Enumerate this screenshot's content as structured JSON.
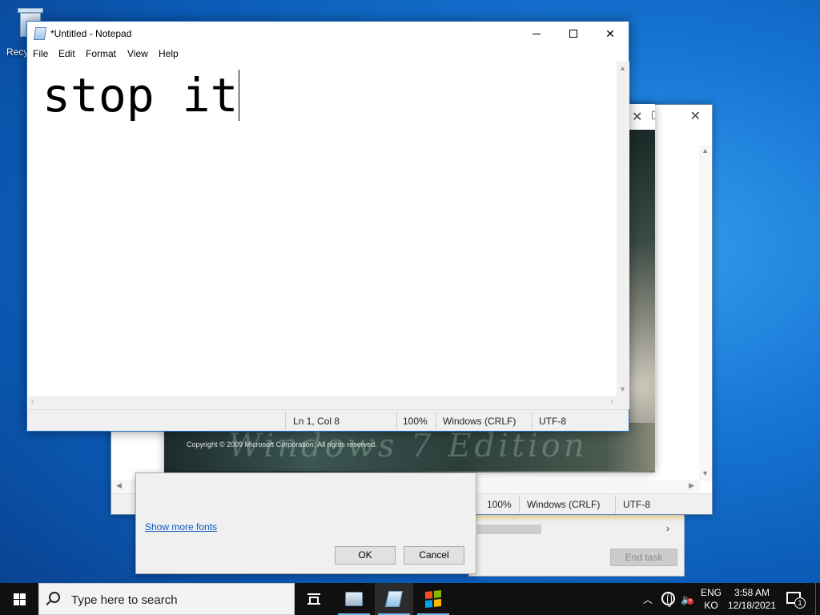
{
  "desktop": {
    "recycle_bin_label": "Recy"
  },
  "notepad": {
    "title": "*Untitled - Notepad",
    "menu": [
      "File",
      "Edit",
      "Format",
      "View",
      "Help"
    ],
    "content": "stop it",
    "status": {
      "position": "Ln 1, Col 8",
      "zoom": "100%",
      "line_ending": "Windows (CRLF)",
      "encoding": "UTF-8"
    }
  },
  "notepad_back": {
    "status": {
      "zoom": "100%",
      "line_ending": "Windows (CRLF)",
      "encoding": "UTF-8"
    }
  },
  "about": {
    "copyright": "Copyright © 2009 Microsoft Corporation. All rights reserved."
  },
  "font_dialog": {
    "show_more_fonts": "Show more fonts",
    "ok": "OK",
    "cancel": "Cancel"
  },
  "task_manager": {
    "end_task": "End task"
  },
  "taskbar": {
    "search_placeholder": "Type here to search",
    "apps": [
      "task-view",
      "control-panel",
      "notepad",
      "windows-flag"
    ],
    "tray": {
      "lang_top": "ENG",
      "lang_bottom": "KO",
      "time": "3:58 AM",
      "date": "12/18/2021",
      "notifications": "1"
    }
  },
  "colors": {
    "accent": "#76b9ed",
    "desktop": "#1778d6",
    "link": "#0a56c5"
  }
}
